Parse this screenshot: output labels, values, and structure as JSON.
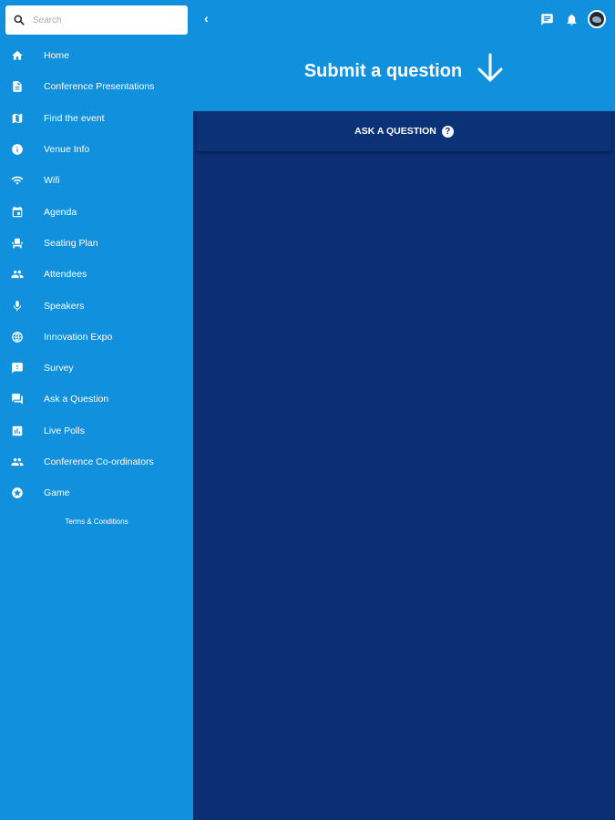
{
  "search": {
    "placeholder": "Search"
  },
  "sidebar": {
    "items": [
      {
        "label": "Home",
        "icon": "home-icon"
      },
      {
        "label": "Conference Presentations",
        "icon": "document-icon"
      },
      {
        "label": "Find the event",
        "icon": "map-icon"
      },
      {
        "label": "Venue Info",
        "icon": "info-icon"
      },
      {
        "label": "Wifi",
        "icon": "wifi-icon"
      },
      {
        "label": "Agenda",
        "icon": "calendar-icon"
      },
      {
        "label": "Seating Plan",
        "icon": "seat-icon"
      },
      {
        "label": "Attendees",
        "icon": "people-icon"
      },
      {
        "label": "Speakers",
        "icon": "microphone-icon"
      },
      {
        "label": "Innovation Expo",
        "icon": "globe-icon"
      },
      {
        "label": "Survey",
        "icon": "feedback-icon"
      },
      {
        "label": "Ask a Question",
        "icon": "forum-icon"
      },
      {
        "label": "Live Polls",
        "icon": "poll-icon"
      },
      {
        "label": "Conference Co-ordinators",
        "icon": "group-icon"
      },
      {
        "label": "Game",
        "icon": "star-badge-icon"
      }
    ],
    "terms": "Terms & Conditions"
  },
  "topbar": {
    "back": "‹",
    "icons": [
      "chat-icon",
      "bell-icon",
      "avatar"
    ]
  },
  "hero": {
    "title": "Submit a question",
    "icon": "arrow-down-icon"
  },
  "ask": {
    "label": "ASK A QUESTION",
    "help": "?"
  },
  "colors": {
    "primary": "#1190de",
    "dark": "#0c2f74",
    "white": "#ffffff"
  }
}
